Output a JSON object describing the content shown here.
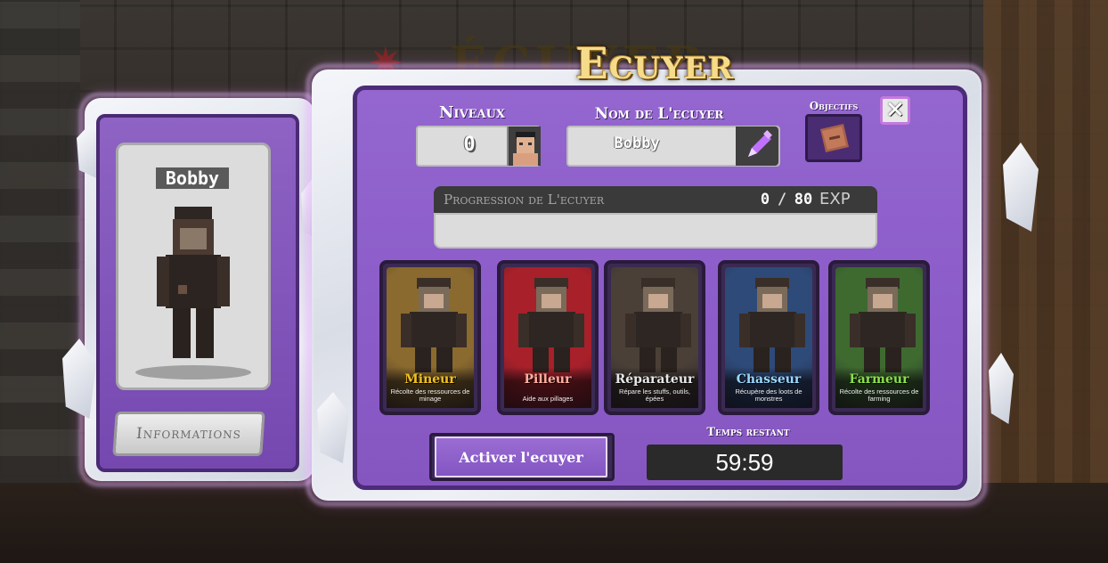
{
  "background": {
    "sign_text": "ÉCUYER"
  },
  "window_title": "Ecuyer",
  "profile": {
    "name": "Bobby",
    "info_button": "Informations"
  },
  "level": {
    "label": "Niveaux",
    "value": "0"
  },
  "squire_name": {
    "label": "Nom de L'ecuyer",
    "value": "Bobby"
  },
  "objectives": {
    "label": "Objectifs"
  },
  "progress": {
    "label": "Progression de L'ecuyer",
    "current": "0",
    "separator": "/",
    "max": "80",
    "unit": "EXP",
    "fraction": 0
  },
  "jobs": [
    {
      "title": "Mineur",
      "desc": "Récolte des ressources de minage",
      "title_color": "#f0c020",
      "bg": "#8a6a2e"
    },
    {
      "title": "Pilleur",
      "desc": "Aide aux pillages",
      "title_color": "#ffb0a0",
      "bg": "#a8202a"
    },
    {
      "title": "Réparateur",
      "desc": "Répare les stuffs, outils, épées",
      "title_color": "#e8e8e8",
      "bg": "#4a4038"
    },
    {
      "title": "Chasseur",
      "desc": "Récupère des loots de monstres",
      "title_color": "#9ad8ff",
      "bg": "#2e4a78"
    },
    {
      "title": "Farmeur",
      "desc": "Récolte des ressources de farming",
      "title_color": "#8be04a",
      "bg": "#3e6a30"
    }
  ],
  "activate_button": "Activer l'ecuyer",
  "timer": {
    "label": "Temps restant",
    "value": "59:59"
  },
  "colors": {
    "panel_purple": "#8b5cc8",
    "panel_border": "#4c2b78",
    "title_gold": "#f6dc8a"
  },
  "icons": [
    "edit-pencil-icon",
    "objectives-book-icon",
    "close-icon",
    "avatar-icon"
  ]
}
